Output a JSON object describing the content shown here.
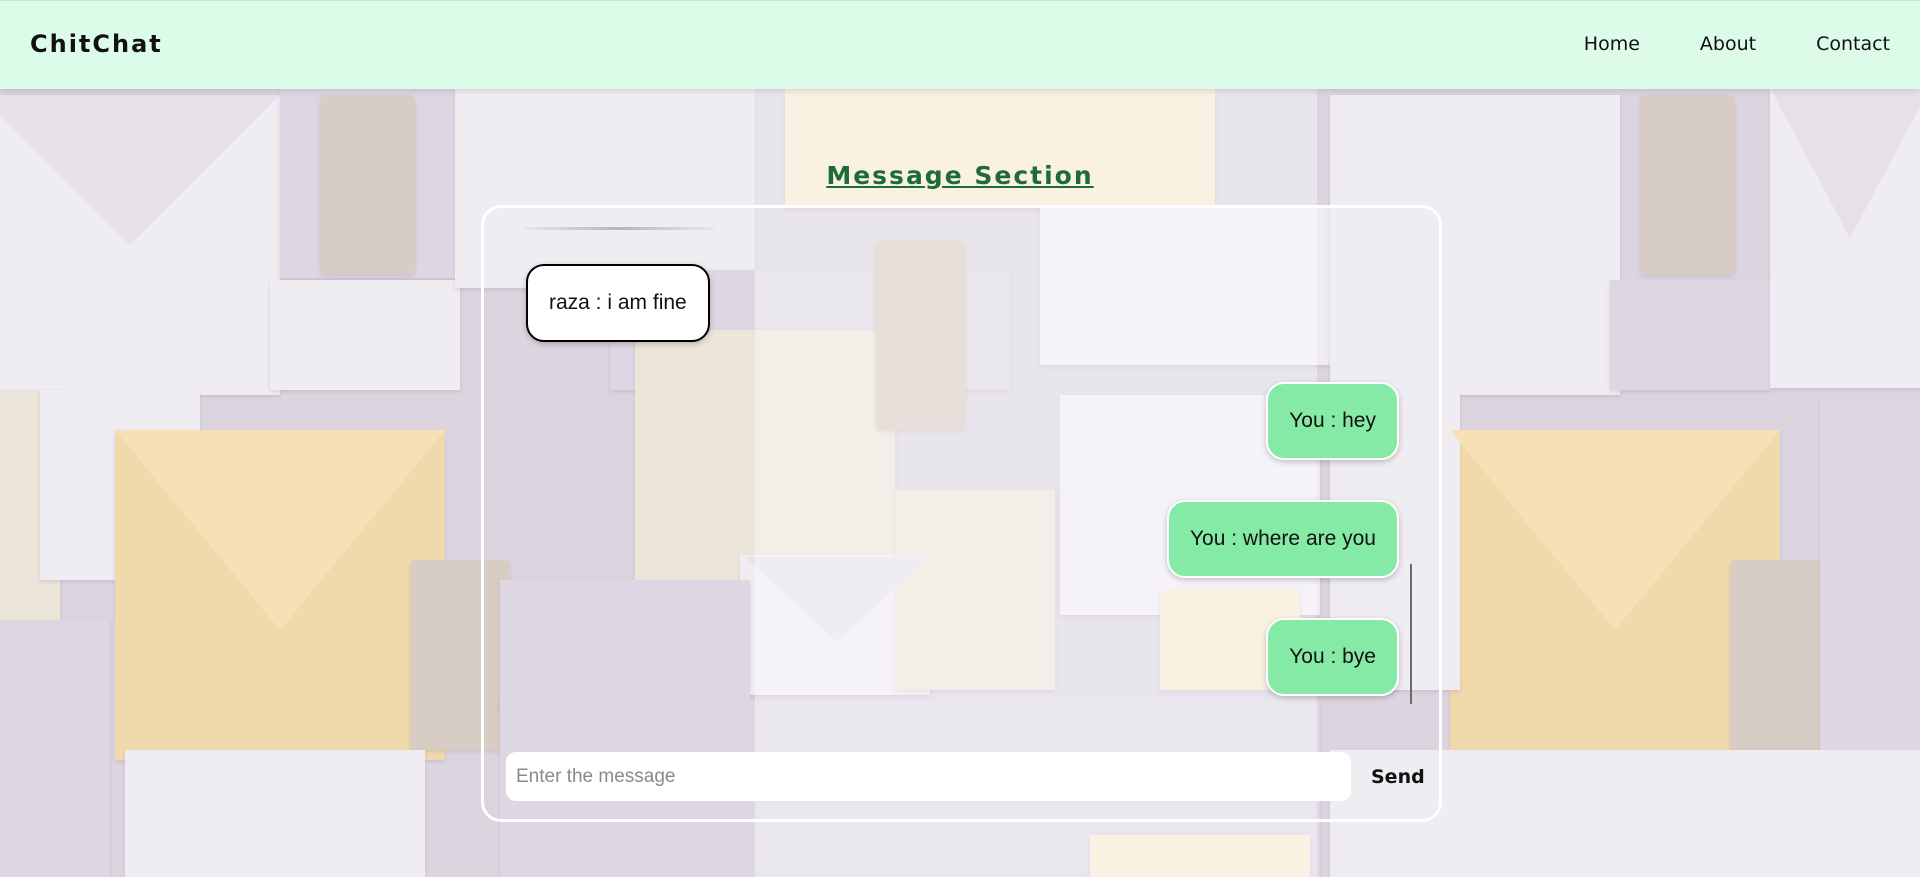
{
  "navbar": {
    "brand": "ChitChat",
    "links": [
      "Home",
      "About",
      "Contact"
    ]
  },
  "heading": "Message Section",
  "messages": [
    {
      "direction": "incoming",
      "text": "raza : i am fine"
    },
    {
      "direction": "outgoing",
      "text": "You : hey"
    },
    {
      "direction": "outgoing",
      "text": "You : where are you"
    },
    {
      "direction": "outgoing",
      "text": "You : bye"
    }
  ],
  "composer": {
    "placeholder": "Enter the message",
    "value": "",
    "send_label": "Send"
  },
  "colors": {
    "navbar_bg": "#dcfbe8",
    "heading": "#1e6b36",
    "outgoing_bubble": "#86eaa7",
    "incoming_bubble": "#ffffff"
  }
}
